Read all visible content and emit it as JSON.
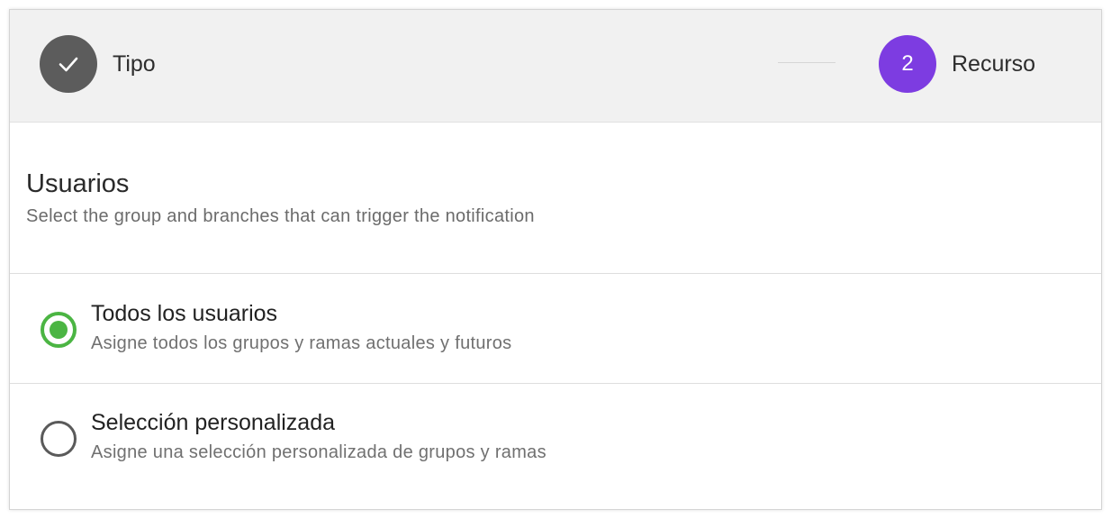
{
  "stepper": {
    "steps": [
      {
        "icon": "check-icon",
        "label": "Tipo",
        "status": "completed"
      },
      {
        "number": "2",
        "label": "Recurso",
        "status": "active"
      }
    ],
    "colors": {
      "completed": "#5c5c5c",
      "active": "#7d3ce1"
    }
  },
  "section": {
    "title": "Usuarios",
    "subtitle": "Select the group and branches that can trigger the notification"
  },
  "options": [
    {
      "title": "Todos los usuarios",
      "description": "Asigne todos los grupos y ramas actuales y futuros",
      "selected": true
    },
    {
      "title": "Selección personalizada",
      "description": "Asigne una selección personalizada de grupos y ramas",
      "selected": false
    }
  ],
  "colors": {
    "radio_selected": "#4bb543"
  }
}
